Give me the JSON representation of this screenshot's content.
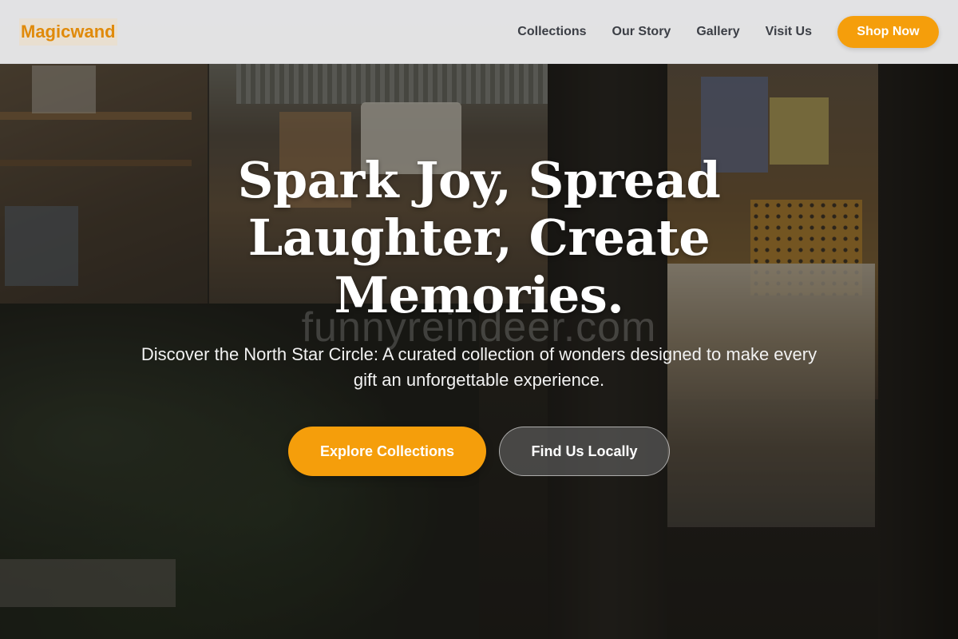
{
  "header": {
    "logo": "Magicwand",
    "nav": [
      {
        "label": "Collections"
      },
      {
        "label": "Our Story"
      },
      {
        "label": "Gallery"
      },
      {
        "label": "Visit Us"
      }
    ],
    "cta_label": "Shop Now"
  },
  "hero": {
    "title": "Spark Joy, Spread Laughter, Create Memories.",
    "watermark": "funnyreindeer.com",
    "subtitle": "Discover the North Star Circle: A curated collection of wonders designed to make every gift an unforgettable experience.",
    "primary_cta": "Explore Collections",
    "secondary_cta": "Find Us Locally"
  },
  "colors": {
    "accent": "#f59e0b",
    "logo": "#e08a0a",
    "nav_text": "#3b3e45"
  }
}
